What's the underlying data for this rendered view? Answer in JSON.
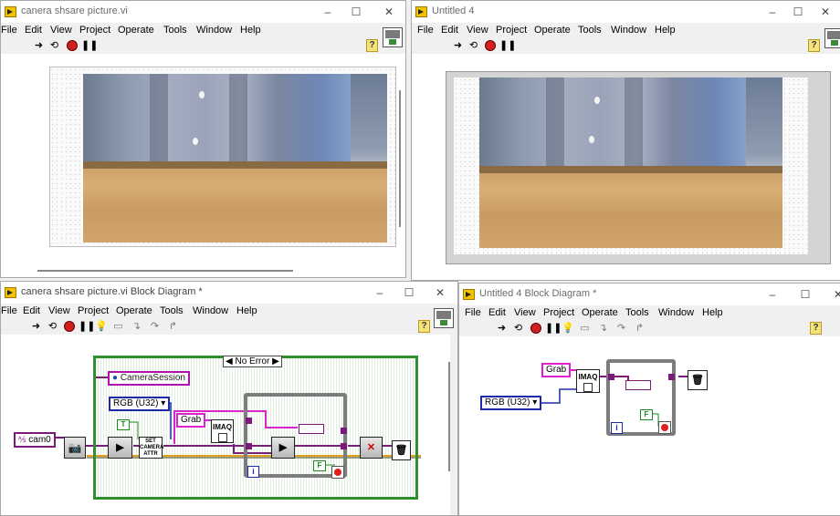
{
  "windows": {
    "fp1": {
      "title": "canera shsare picture.vi"
    },
    "fp2": {
      "title": "Untitled 4"
    },
    "bd1": {
      "title": "canera shsare picture.vi Block Diagram *"
    },
    "bd2": {
      "title": "Untitled 4 Block Diagram *"
    }
  },
  "menu": [
    "File",
    "Edit",
    "View",
    "Project",
    "Operate",
    "Tools",
    "Window",
    "Help"
  ],
  "icons": {
    "run": "run-arrow-icon",
    "run_continuous": "run-continuously-icon",
    "abort": "abort-icon",
    "pause": "pause-icon",
    "highlight": "highlight-execution-icon",
    "help": "context-help-icon"
  },
  "glyphs": {
    "help": "?",
    "minimize": "–",
    "maximize": "☐",
    "close": "✕",
    "iteration": "i",
    "false": "F",
    "true": "T"
  },
  "diagram1": {
    "camera_name": "cam0",
    "session_name": "CameraSession",
    "image_type": "RGB (U32)",
    "grab_label": "Grab",
    "case_selector": "No Error",
    "imaq_label": "IMAQ",
    "set_attr_label": "SET\nCAMERA\nATTR"
  },
  "diagram2": {
    "grab_label": "Grab",
    "image_type": "RGB (U32)",
    "imaq_label": "IMAQ"
  },
  "colors": {
    "string_wire": "#e020d0",
    "enum_wire": "#1c2aa8",
    "case_border": "#2f8f2f",
    "while_border": "#7d7d7d",
    "error_wire": "#e8a020"
  }
}
